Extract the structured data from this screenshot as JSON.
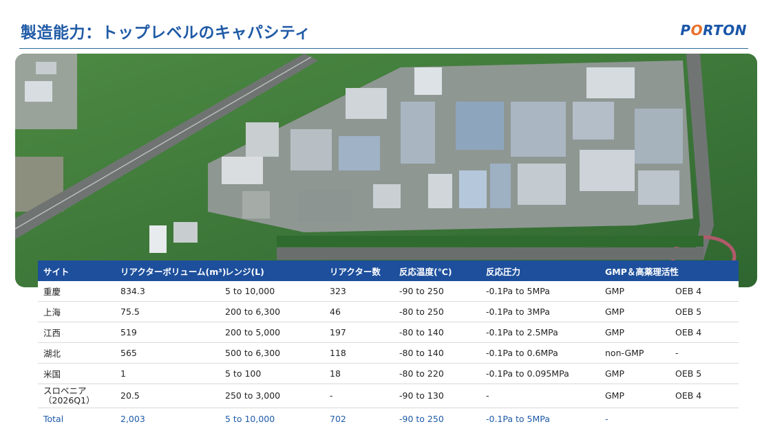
{
  "header": {
    "title": "製造能力：トップレベルのキャパシティ",
    "logo_text_a": "P",
    "logo_text_b": "O",
    "logo_text_c": "RTON"
  },
  "table": {
    "columns": [
      "サイト",
      "リアクターボリューム(m³)",
      "レンジ(L)",
      "リアクター数",
      "反応温度(℃)",
      "反応圧力",
      "GMP＆高薬理活性",
      ""
    ],
    "rows": [
      {
        "site": "重慶",
        "volume": "834.3",
        "range": "5 to 10,000",
        "count": "323",
        "temp": "-90 to 250",
        "pressure": "-0.1Pa to 5MPa",
        "gmp": "GMP",
        "oeb": "OEB 4"
      },
      {
        "site": "上海",
        "volume": "75.5",
        "range": "200 to 6,300",
        "count": "46",
        "temp": "-80 to 250",
        "pressure": "-0.1Pa to 3MPa",
        "gmp": "GMP",
        "oeb": "OEB 5"
      },
      {
        "site": "江西",
        "volume": "519",
        "range": "200 to 5,000",
        "count": "197",
        "temp": "-80 to 140",
        "pressure": "-0.1Pa to 2.5MPa",
        "gmp": "GMP",
        "oeb": "OEB 4"
      },
      {
        "site": "湖北",
        "volume": "565",
        "range": "500 to 6,300",
        "count": "118",
        "temp": "-80 to 140",
        "pressure": "-0.1Pa to 0.6MPa",
        "gmp": "non-GMP",
        "oeb": "-"
      },
      {
        "site": "米国",
        "volume": "1",
        "range": "5 to 100",
        "count": "18",
        "temp": "-80 to 220",
        "pressure": "-0.1Pa to 0.095MPa",
        "gmp": "GMP",
        "oeb": "OEB 5"
      },
      {
        "site": "スロベニア\n（2026Q1）",
        "volume": "20.5",
        "range": "250 to 3,000",
        "count": "-",
        "temp": "-90 to 130",
        "pressure": "-",
        "gmp": "GMP",
        "oeb": "OEB 4"
      }
    ],
    "total": {
      "site": "Total",
      "volume": "2,003",
      "range": "5 to 10,000",
      "count": "702",
      "temp": "-90 to 250",
      "pressure": "-0.1Pa to 5MPa",
      "gmp": "-",
      "oeb": ""
    }
  },
  "colors": {
    "title": "#1f5aa6",
    "header_bg": "#1d4f9c",
    "total_text": "#1d5aa8",
    "logo_accent": "#e8702a"
  }
}
